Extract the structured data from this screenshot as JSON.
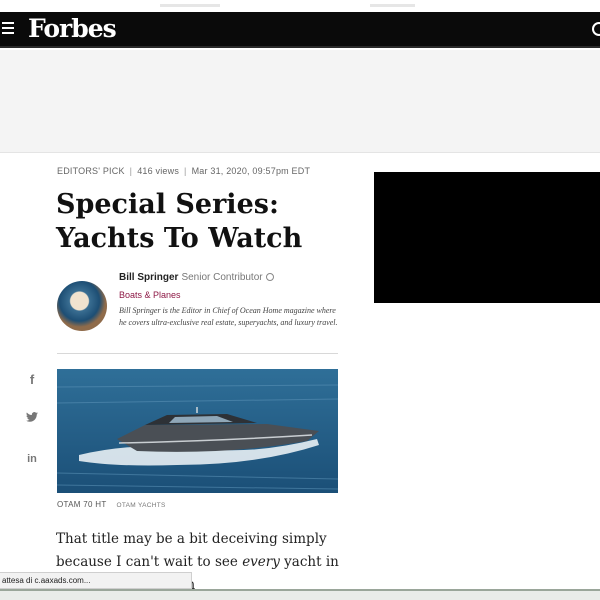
{
  "brand": {
    "logo_text": "Forbes"
  },
  "navbar": {
    "menu_icon": "hamburger-menu-icon",
    "search_icon": "search-icon",
    "background": "#0a0a0a"
  },
  "article": {
    "eyebrow": "EDITORS' PICK",
    "views": "416 views",
    "date": "Mar 31, 2020, 09:57pm EDT",
    "title": "Special Series: Yachts To Watch",
    "author": {
      "name": "Bill Springer",
      "role": "Senior Contributor",
      "channel": "Boats & Planes",
      "bio": "Bill Springer is the Editor in Chief of Ocean Home magazine where he covers ultra-exclusive real estate, superyachts, and luxury travel."
    },
    "image_caption": "OTAM 70 HT",
    "image_credit": "OTAM YACHTS",
    "body_start": "That title may be a bit deceiving simply because I can't wait to see",
    "body_em": "every",
    "body_end": "yacht in world recovers from"
  },
  "share": {
    "facebook": "f",
    "linkedin": "in"
  },
  "status_bar": {
    "text": "attesa di c.aaxads.com..."
  },
  "colors": {
    "accent": "#8d1845",
    "video_box": "#000000"
  }
}
